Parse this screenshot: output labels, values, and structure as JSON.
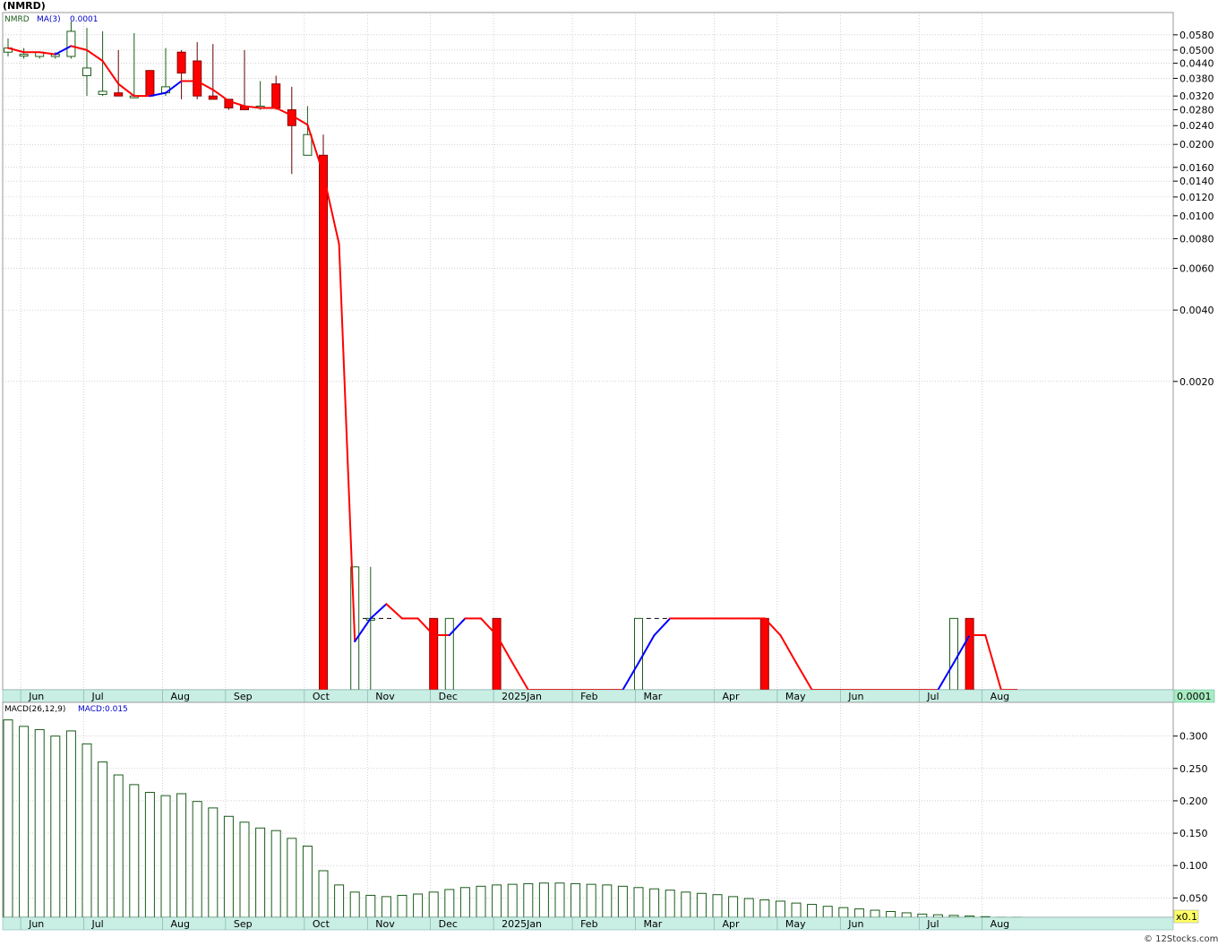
{
  "title": "(NMRD)",
  "credit": "© 12Stocks.com",
  "colors": {
    "up": "#1a5c1a",
    "down": "#ff0000",
    "ma_up": "#0000ff",
    "ma_down": "#ff0000",
    "macd_bar": "#1a5c1a",
    "band": "#c9eee3",
    "grid": "#b4b4b4",
    "last_price_box": "#a8ecc0",
    "scale_box": "#ffff66"
  },
  "price_panel": {
    "legend": {
      "ticker": "NMRD",
      "ma_label": "MA(3)",
      "ma_value": "0.0001"
    },
    "last_price": "0.0001",
    "month_labels": [
      "Jun",
      "Jul",
      "Aug",
      "Sep",
      "Oct",
      "Nov",
      "Dec",
      "2025Jan",
      "Feb",
      "Mar",
      "Apr",
      "May",
      "Jun",
      "Jul",
      "Aug"
    ]
  },
  "macd_panel": {
    "legend_name": "MACD(26,12,9)",
    "legend_value": "MACD:0.015",
    "scale_note": "x0.1",
    "y_tick_labels": [
      "0.300",
      "0.250",
      "0.200",
      "0.150",
      "0.100",
      "0.050"
    ]
  },
  "chart_data": [
    {
      "type": "candlestick",
      "title": "(NMRD)",
      "x_unit": "week index (2024 Jun – 2025 Aug)",
      "y_scale": "log",
      "y_tick_labels": [
        "0.0580",
        "0.0500",
        "0.0440",
        "0.0380",
        "0.0320",
        "0.0280",
        "0.0240",
        "0.0200",
        "0.0160",
        "0.0140",
        "0.0120",
        "0.0100",
        "0.0080",
        "0.0060",
        "0.0040",
        "0.0020"
      ],
      "ylim": [
        0.0001,
        0.066
      ],
      "month_starts": [
        {
          "label": "Jun",
          "week": 0.8
        },
        {
          "label": "Jul",
          "week": 4.8
        },
        {
          "label": "Aug",
          "week": 9.8
        },
        {
          "label": "Sep",
          "week": 13.8
        },
        {
          "label": "Oct",
          "week": 18.8
        },
        {
          "label": "Nov",
          "week": 22.8
        },
        {
          "label": "Dec",
          "week": 26.8
        },
        {
          "label": "2025Jan",
          "week": 30.8
        },
        {
          "label": "Feb",
          "week": 35.8
        },
        {
          "label": "Mar",
          "week": 39.8
        },
        {
          "label": "Apr",
          "week": 44.8
        },
        {
          "label": "May",
          "week": 48.8
        },
        {
          "label": "Jun",
          "week": 52.8
        },
        {
          "label": "Jul",
          "week": 57.8
        },
        {
          "label": "Aug",
          "week": 61.8
        }
      ],
      "candles": [
        {
          "w": 0,
          "o": 0.049,
          "h": 0.056,
          "l": 0.047,
          "c": 0.051
        },
        {
          "w": 1,
          "o": 0.048,
          "h": 0.051,
          "l": 0.046,
          "c": 0.048
        },
        {
          "w": 2,
          "o": 0.047,
          "h": 0.049,
          "l": 0.046,
          "c": 0.049
        },
        {
          "w": 3,
          "o": 0.047,
          "h": 0.049,
          "l": 0.046,
          "c": 0.048
        },
        {
          "w": 4,
          "o": 0.047,
          "h": 0.066,
          "l": 0.046,
          "c": 0.06
        },
        {
          "w": 5,
          "o": 0.039,
          "h": 0.062,
          "l": 0.032,
          "c": 0.042
        },
        {
          "w": 6,
          "o": 0.0325,
          "h": 0.06,
          "l": 0.032,
          "c": 0.0335
        },
        {
          "w": 7,
          "o": 0.033,
          "h": 0.05,
          "l": 0.032,
          "c": 0.032
        },
        {
          "w": 8,
          "o": 0.032,
          "h": 0.059,
          "l": 0.032,
          "c": 0.032
        },
        {
          "w": 9,
          "o": 0.041,
          "h": 0.041,
          "l": 0.032,
          "c": 0.032
        },
        {
          "w": 10,
          "o": 0.033,
          "h": 0.051,
          "l": 0.032,
          "c": 0.035
        },
        {
          "w": 11,
          "o": 0.049,
          "h": 0.05,
          "l": 0.031,
          "c": 0.04
        },
        {
          "w": 12,
          "o": 0.045,
          "h": 0.054,
          "l": 0.031,
          "c": 0.032
        },
        {
          "w": 13,
          "o": 0.032,
          "h": 0.053,
          "l": 0.031,
          "c": 0.031
        },
        {
          "w": 14,
          "o": 0.031,
          "h": 0.031,
          "l": 0.028,
          "c": 0.0285
        },
        {
          "w": 15,
          "o": 0.029,
          "h": 0.05,
          "l": 0.028,
          "c": 0.028
        },
        {
          "w": 16,
          "o": 0.0285,
          "h": 0.037,
          "l": 0.028,
          "c": 0.029
        },
        {
          "w": 17,
          "o": 0.036,
          "h": 0.039,
          "l": 0.028,
          "c": 0.0285
        },
        {
          "w": 18,
          "o": 0.028,
          "h": 0.035,
          "l": 0.015,
          "c": 0.024
        },
        {
          "w": 19,
          "o": 0.018,
          "h": 0.029,
          "l": 0.018,
          "c": 0.022
        },
        {
          "w": 20,
          "o": 0.018,
          "h": 0.022,
          "l": 0.0001,
          "c": 0.0001
        },
        {
          "w": 22,
          "o": 0.0001,
          "h": 0.00033,
          "l": 0.0001,
          "c": 0.00033
        },
        {
          "w": 23,
          "o": 0.0002,
          "h": 0.00033,
          "l": 0.0001,
          "c": 0.0002
        },
        {
          "w": 27,
          "o": 0.0002,
          "h": 0.0002,
          "l": 0.0001,
          "c": 0.0001
        },
        {
          "w": 28,
          "o": 0.0001,
          "h": 0.0002,
          "l": 0.0001,
          "c": 0.0002
        },
        {
          "w": 31,
          "o": 0.0002,
          "h": 0.0002,
          "l": 0.0001,
          "c": 0.0001
        },
        {
          "w": 40,
          "o": 0.0001,
          "h": 0.0002,
          "l": 0.0001,
          "c": 0.0002
        },
        {
          "w": 48,
          "o": 0.0002,
          "h": 0.0002,
          "l": 0.0001,
          "c": 0.0001
        },
        {
          "w": 60,
          "o": 0.0001,
          "h": 0.0002,
          "l": 0.0001,
          "c": 0.0002
        },
        {
          "w": 61,
          "o": 0.0002,
          "h": 0.0002,
          "l": 0.0001,
          "c": 0.0001
        }
      ],
      "dashed_segments": [
        {
          "from_w": 22.5,
          "to_w": 24.5,
          "y": 0.0002
        },
        {
          "from_w": 40.5,
          "to_w": 42.5,
          "y": 0.0002
        }
      ],
      "ma": {
        "name": "MA(3)",
        "points": [
          {
            "w": 0,
            "v": 0.051
          },
          {
            "w": 1,
            "v": 0.049
          },
          {
            "w": 2,
            "v": 0.049
          },
          {
            "w": 3,
            "v": 0.048
          },
          {
            "w": 4,
            "v": 0.052
          },
          {
            "w": 5,
            "v": 0.05
          },
          {
            "w": 6,
            "v": 0.045
          },
          {
            "w": 7,
            "v": 0.036
          },
          {
            "w": 8,
            "v": 0.032
          },
          {
            "w": 9,
            "v": 0.032
          },
          {
            "w": 10,
            "v": 0.033
          },
          {
            "w": 11,
            "v": 0.037
          },
          {
            "w": 12,
            "v": 0.037
          },
          {
            "w": 13,
            "v": 0.034
          },
          {
            "w": 14,
            "v": 0.0305
          },
          {
            "w": 15,
            "v": 0.029
          },
          {
            "w": 16,
            "v": 0.0285
          },
          {
            "w": 17,
            "v": 0.0285
          },
          {
            "w": 18,
            "v": 0.0265
          },
          {
            "w": 19,
            "v": 0.0242
          },
          {
            "w": 20,
            "v": 0.015
          },
          {
            "w": 21,
            "v": 0.0076
          },
          {
            "w": 22,
            "v": 0.00016
          },
          {
            "w": 23,
            "v": 0.0002
          },
          {
            "w": 24,
            "v": 0.00023
          },
          {
            "w": 25,
            "v": 0.0002
          },
          {
            "w": 26,
            "v": 0.0002
          },
          {
            "w": 27,
            "v": 0.00017
          },
          {
            "w": 28,
            "v": 0.00017
          },
          {
            "w": 29,
            "v": 0.0002
          },
          {
            "w": 30,
            "v": 0.0002
          },
          {
            "w": 31,
            "v": 0.00017
          },
          {
            "w": 32,
            "v": 0.00013
          },
          {
            "w": 33,
            "v": 0.0001
          },
          {
            "w": 34,
            "v": 0.0001
          },
          {
            "w": 35,
            "v": 0.0001
          },
          {
            "w": 36,
            "v": 0.0001
          },
          {
            "w": 37,
            "v": 0.0001
          },
          {
            "w": 38,
            "v": 0.0001
          },
          {
            "w": 39,
            "v": 0.0001
          },
          {
            "w": 40,
            "v": 0.00013
          },
          {
            "w": 41,
            "v": 0.00017
          },
          {
            "w": 42,
            "v": 0.0002
          },
          {
            "w": 43,
            "v": 0.0002
          },
          {
            "w": 44,
            "v": 0.0002
          },
          {
            "w": 45,
            "v": 0.0002
          },
          {
            "w": 46,
            "v": 0.0002
          },
          {
            "w": 47,
            "v": 0.0002
          },
          {
            "w": 48,
            "v": 0.0002
          },
          {
            "w": 49,
            "v": 0.00017
          },
          {
            "w": 50,
            "v": 0.00013
          },
          {
            "w": 51,
            "v": 0.0001
          },
          {
            "w": 52,
            "v": 0.0001
          },
          {
            "w": 53,
            "v": 0.0001
          },
          {
            "w": 54,
            "v": 0.0001
          },
          {
            "w": 55,
            "v": 0.0001
          },
          {
            "w": 56,
            "v": 0.0001
          },
          {
            "w": 57,
            "v": 0.0001
          },
          {
            "w": 58,
            "v": 0.0001
          },
          {
            "w": 59,
            "v": 0.0001
          },
          {
            "w": 60,
            "v": 0.00013
          },
          {
            "w": 61,
            "v": 0.00017
          },
          {
            "w": 62,
            "v": 0.00017
          },
          {
            "w": 63,
            "v": 0.0001
          },
          {
            "w": 64,
            "v": 0.0001
          }
        ]
      }
    },
    {
      "type": "bar",
      "title": "MACD(26,12,9)",
      "ylim": [
        0.02,
        0.33
      ],
      "y_ticks": [
        0.3,
        0.25,
        0.2,
        0.15,
        0.1,
        0.05
      ],
      "values": [
        0.325,
        0.315,
        0.31,
        0.3,
        0.308,
        0.288,
        0.26,
        0.24,
        0.225,
        0.213,
        0.208,
        0.211,
        0.199,
        0.189,
        0.176,
        0.167,
        0.158,
        0.154,
        0.142,
        0.13,
        0.092,
        0.07,
        0.059,
        0.054,
        0.052,
        0.054,
        0.056,
        0.059,
        0.063,
        0.066,
        0.068,
        0.07,
        0.071,
        0.072,
        0.073,
        0.073,
        0.072,
        0.071,
        0.07,
        0.068,
        0.066,
        0.064,
        0.062,
        0.059,
        0.057,
        0.055,
        0.052,
        0.049,
        0.047,
        0.045,
        0.042,
        0.04,
        0.037,
        0.035,
        0.033,
        0.031,
        0.029,
        0.027,
        0.025,
        0.024,
        0.023,
        0.022,
        0.021,
        0.02,
        0.02
      ]
    }
  ]
}
